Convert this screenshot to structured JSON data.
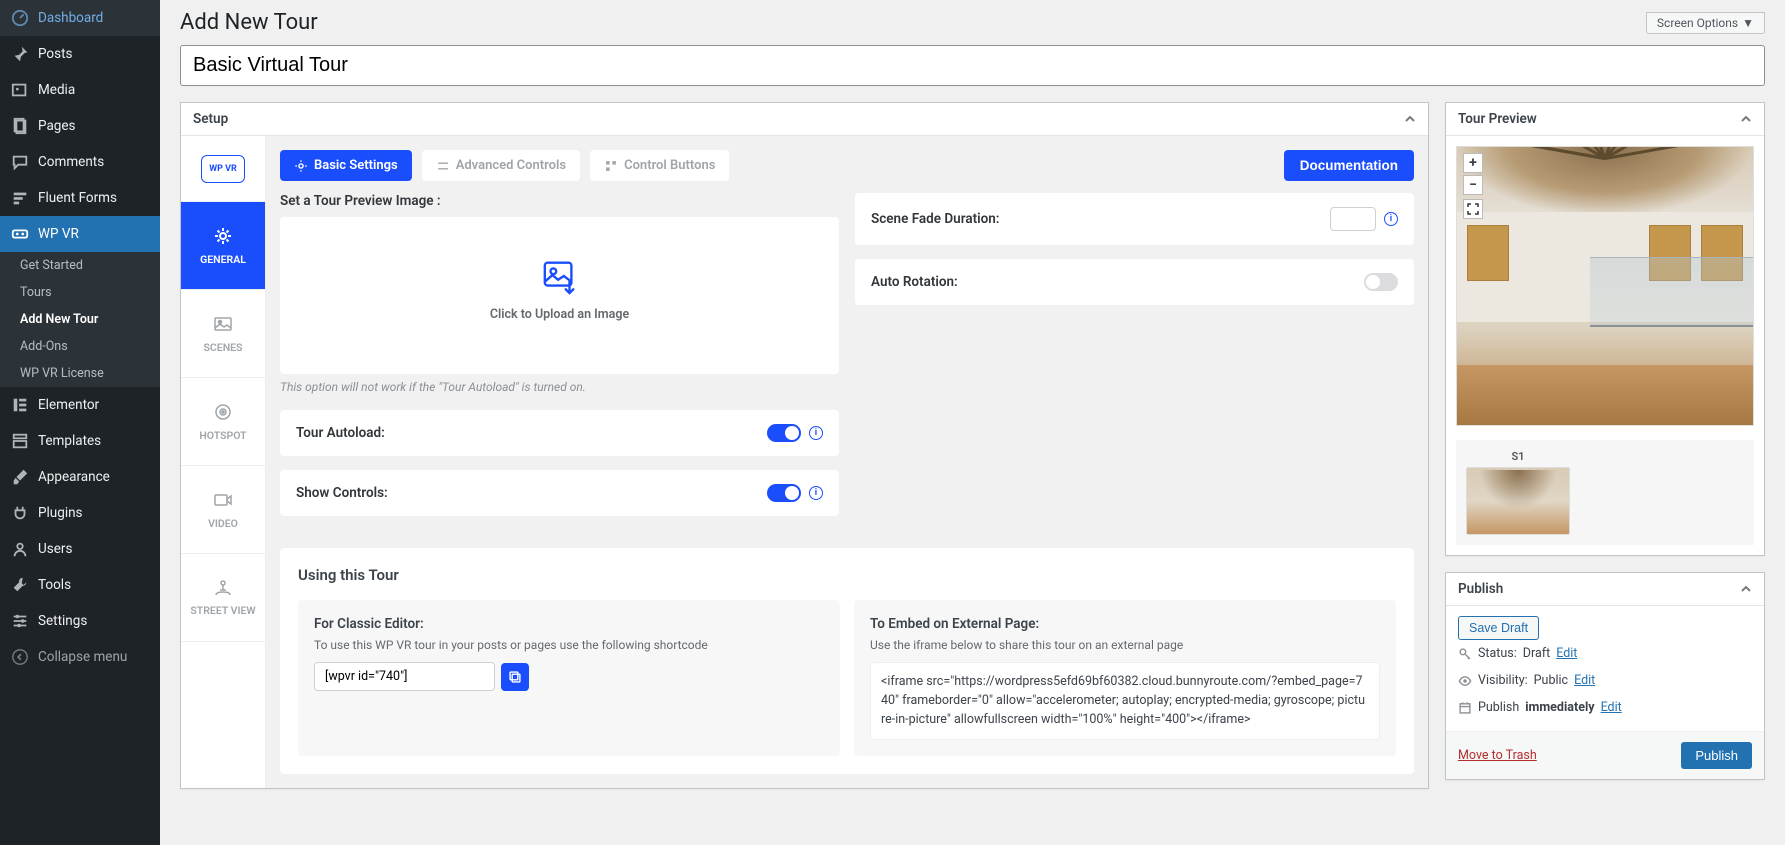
{
  "screen_options": "Screen Options",
  "page_title": "Add New Tour",
  "tour_title": "Basic Virtual Tour",
  "sidebar": {
    "items": [
      {
        "label": "Dashboard"
      },
      {
        "label": "Posts"
      },
      {
        "label": "Media"
      },
      {
        "label": "Pages"
      },
      {
        "label": "Comments"
      },
      {
        "label": "Fluent Forms"
      },
      {
        "label": "WP VR"
      },
      {
        "label": "Elementor"
      },
      {
        "label": "Templates"
      },
      {
        "label": "Appearance"
      },
      {
        "label": "Plugins"
      },
      {
        "label": "Users"
      },
      {
        "label": "Tools"
      },
      {
        "label": "Settings"
      }
    ],
    "sub": [
      "Get Started",
      "Tours",
      "Add New Tour",
      "Add-Ons",
      "WP VR License"
    ],
    "collapse": "Collapse menu"
  },
  "setup": {
    "box_title": "Setup",
    "logo_text": "WP VR",
    "tabs": [
      "GENERAL",
      "SCENES",
      "HOTSPOT",
      "VIDEO",
      "STREET VIEW"
    ],
    "top_tabs": {
      "basic": "Basic Settings",
      "advanced": "Advanced Controls",
      "buttons": "Control Buttons"
    },
    "doc_btn": "Documentation",
    "preview_label": "Set a Tour Preview Image :",
    "upload_text": "Click to Upload an Image",
    "preview_hint": "This option will not work if the \"Tour Autoload\" is turned on.",
    "fade_label": "Scene Fade Duration:",
    "fade_value": "",
    "autorot_label": "Auto Rotation:",
    "autoload_label": "Tour Autoload:",
    "controls_label": "Show Controls:",
    "using": {
      "title": "Using this Tour",
      "classic_h": "For Classic Editor:",
      "classic_p": "To use this WP VR tour in your posts or pages use the following shortcode",
      "shortcode": "[wpvr id=\"740\"]",
      "embed_h": "To Embed on External Page:",
      "embed_p": "Use the iframe below to share this tour on an external page",
      "iframe": "<iframe src=\"https://wordpress5efd69bf60382.cloud.bunnyroute.com/?embed_page=740\" frameborder=\"0\" allow=\"accelerometer; autoplay; encrypted-media; gyroscope; picture-in-picture\" allowfullscreen width=\"100%\" height=\"400\"></iframe>"
    }
  },
  "preview": {
    "box_title": "Tour Preview",
    "scene_label": "S1"
  },
  "publish": {
    "box_title": "Publish",
    "save_draft": "Save Draft",
    "status_label": "Status:",
    "status_value": "Draft",
    "visibility_label": "Visibility:",
    "visibility_value": "Public",
    "schedule_label": "Publish",
    "schedule_value": "immediately",
    "edit": "Edit",
    "trash": "Move to Trash",
    "publish_btn": "Publish"
  }
}
